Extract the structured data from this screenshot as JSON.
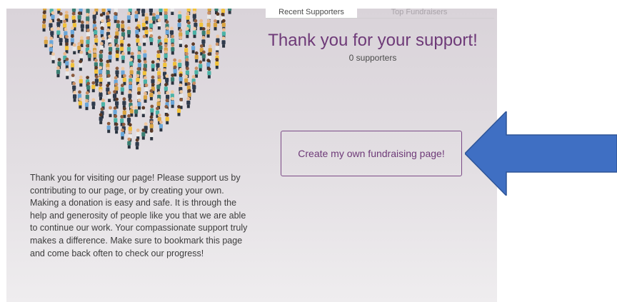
{
  "tabs": {
    "recent_supporters": "Recent Supporters",
    "top_fundraisers": "Top Fundraisers"
  },
  "support": {
    "heading": "Thank you for your support!",
    "count": "0 supporters"
  },
  "create_button_label": "Create my own fundraising page!",
  "intro_text": "Thank you for visiting our page! Please support us by contributing to our page, or by creating your own. Making a donation is easy and safe. It is through the help and generosity of people like you that we are able to continue our work. Your compassionate support truly makes a difference. Make sure to bookmark this page and come back often to check our progress!",
  "colors": {
    "accent_purple": "#6e3a78",
    "arrow_blue": "#3f6fc3",
    "panel_background": "#dcd7dc"
  },
  "icons": {
    "heart_image": "people-heart-illustration",
    "pointer_arrow": "left-arrow-icon"
  }
}
